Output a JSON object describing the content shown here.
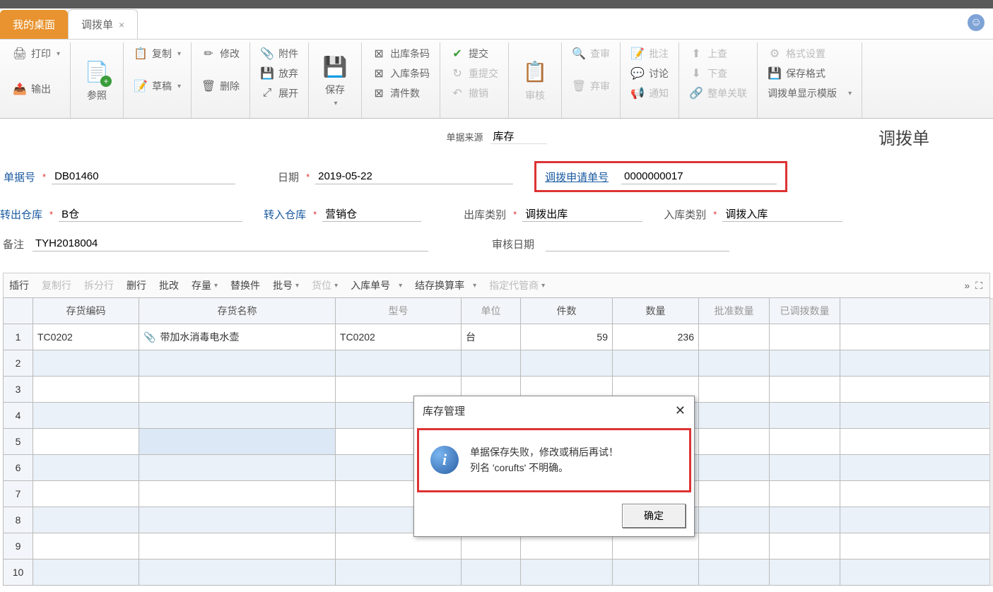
{
  "tabs": [
    "我的桌面",
    "调拨单"
  ],
  "ribbon": {
    "print": "打印",
    "export": "输出",
    "reference": "参照",
    "copy": "复制",
    "draft": "草稿",
    "modify": "修改",
    "delete": "删除",
    "attachment": "附件",
    "discard": "放弃",
    "expand": "展开",
    "save": "保存",
    "outBarcode": "出库条码",
    "inBarcode": "入库条码",
    "clearCount": "清件数",
    "submit": "提交",
    "resubmit": "重提交",
    "revoke": "撤销",
    "audit": "审核",
    "review": "查审",
    "abandon": "弃审",
    "annotate": "批注",
    "discuss": "讨论",
    "notify": "通知",
    "prev": "上查",
    "next": "下查",
    "wholeLink": "整单关联",
    "formatSettings": "格式设置",
    "saveFormat": "保存格式",
    "template": "调拨单显示模版"
  },
  "header": {
    "sourceLabel": "单据来源",
    "sourceValue": "库存",
    "title": "调拨单"
  },
  "form": {
    "docNo": {
      "label": "单据号",
      "value": "DB01460"
    },
    "date": {
      "label": "日期",
      "value": "2019-05-22"
    },
    "requestNo": {
      "label": "调拨申请单号",
      "value": "0000000017"
    },
    "outWh": {
      "label": "转出仓库",
      "value": "B仓"
    },
    "inWh": {
      "label": "转入仓库",
      "value": "营销仓"
    },
    "outType": {
      "label": "出库类别",
      "value": "调拨出库"
    },
    "inType": {
      "label": "入库类别",
      "value": "调拨入库"
    },
    "remark": {
      "label": "备注",
      "value": "TYH2018004"
    },
    "auditDate": {
      "label": "审核日期",
      "value": ""
    }
  },
  "gridToolbar": [
    "插行",
    "复制行",
    "拆分行",
    "删行",
    "批改",
    "存量",
    "替换件",
    "批号",
    "货位",
    "入库单号",
    "结存换算率",
    "指定代管商"
  ],
  "grid": {
    "columns": [
      "存货编码",
      "存货名称",
      "型号",
      "单位",
      "件数",
      "数量",
      "批准数量",
      "已调拨数量"
    ],
    "rows": [
      {
        "n": "1",
        "code": "TC0202",
        "name": "带加水消毒电水壶",
        "model": "TC0202",
        "unit": "台",
        "pieces": "59",
        "qty": "236"
      },
      {
        "n": "2"
      },
      {
        "n": "3"
      },
      {
        "n": "4"
      },
      {
        "n": "5"
      },
      {
        "n": "6"
      },
      {
        "n": "7"
      },
      {
        "n": "8"
      },
      {
        "n": "9"
      },
      {
        "n": "10"
      }
    ]
  },
  "dialog": {
    "title": "库存管理",
    "line1": "单据保存失败，修改或稍后再试！",
    "line2": "列名 'corufts' 不明确。",
    "ok": "确定"
  }
}
